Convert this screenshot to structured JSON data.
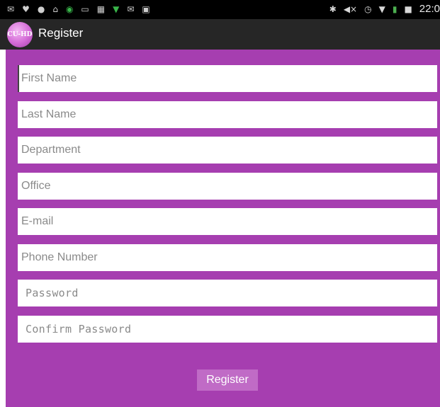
{
  "status_bar": {
    "time": "22:0"
  },
  "app_bar": {
    "logo_text": "CU-HD",
    "title": "Register"
  },
  "form": {
    "first_name": {
      "placeholder": "First Name",
      "value": ""
    },
    "last_name": {
      "placeholder": "Last Name",
      "value": ""
    },
    "department": {
      "placeholder": "Department",
      "value": ""
    },
    "office": {
      "placeholder": "Office",
      "value": ""
    },
    "email": {
      "placeholder": "E-mail",
      "value": ""
    },
    "phone": {
      "placeholder": "Phone Number",
      "value": ""
    },
    "password": {
      "placeholder": "Password",
      "value": ""
    },
    "confirm_password": {
      "placeholder": "Confirm Password",
      "value": ""
    },
    "submit_label": "Register"
  },
  "colors": {
    "form_background": "#a63eb0",
    "button_background": "#c06bc6",
    "app_bar": "#262626"
  },
  "icons": {
    "status_left": [
      "mail-icon",
      "twitter-icon",
      "chat-icon",
      "email-icon",
      "app-icon",
      "image-icon",
      "qr-icon",
      "download-icon",
      "message-icon",
      "screenshot-icon"
    ],
    "status_right": [
      "bluetooth-icon",
      "mute-icon",
      "alarm-icon",
      "wifi-icon",
      "signal-icon",
      "battery-icon"
    ]
  }
}
